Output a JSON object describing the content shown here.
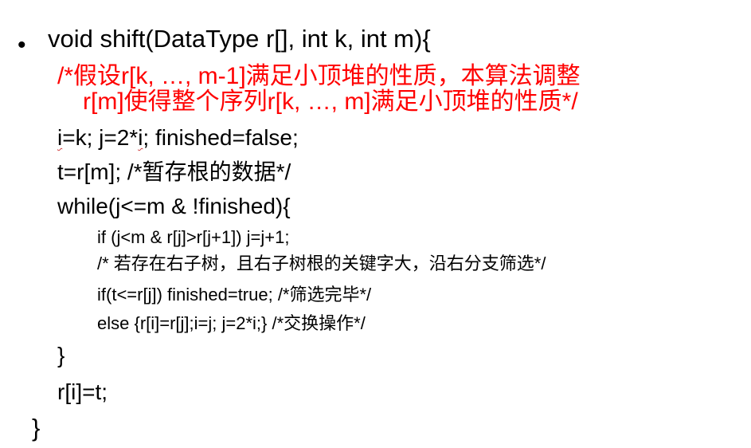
{
  "slide": {
    "bullet": "•",
    "signature": "void shift(DataType r[], int k, int m){",
    "comment_line1": "/*假设r[k, …, m-1]满足小顶堆的性质，本算法调整",
    "comment_line2": "r[m]使得整个序列r[k, …, m]满足小顶堆的性质*/",
    "init_i": "i",
    "init_mid": "=k; j=2*",
    "init_i2": "i",
    "init_tail": "; finished=false;",
    "assign_t": "t=r[m];  /*暂存根的数据*/",
    "while_head": "while(j<=m & !finished){",
    "if_right_child": "if (j<m & r[j]>r[j+1]) j=j+1;",
    "comment_right": "/* 若存在右子树，且右子树根的关键字大，沿右分支筛选*/",
    "if_finished": "if(t<=r[j]) finished=true; /*筛选完毕*/",
    "else_swap": "else {r[i]=r[j];i=j; j=2*i;}  /*交换操作*/",
    "close_while": "}",
    "assign_ri": "r[i]=t;",
    "close_func": "}"
  }
}
